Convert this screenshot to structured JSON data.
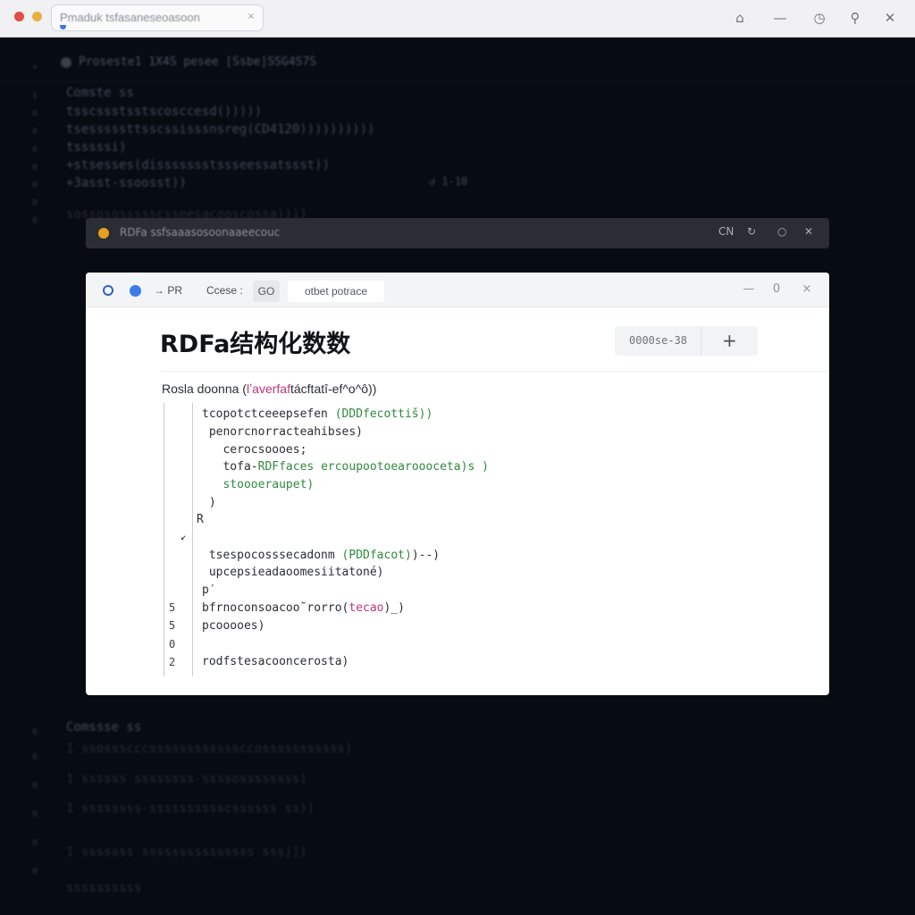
{
  "browser": {
    "address_text": "Pmaduk tsfasaneseoasoon",
    "close_tab": "×",
    "icons": [
      "home-icon",
      "minimize-icon",
      "history-icon",
      "search-icon",
      "close-icon"
    ]
  },
  "background_editor": {
    "toolbar_text": "Proseste1    1X4S  pesee    [Ssbe]SSG4S7S",
    "lines": [
      "Comste ss",
      "    tsscssstsstscosccesd()))))",
      "    tsesssssttsscssisssnsreg(CD4120))))))))))",
      "    tsssssi)",
      "    +stsesses(dissssssstssseessatssst))",
      "    +3asst-ssoosst))",
      "    sossosossssscsseesacooscossa))))",
      "Comssse ss",
      "    1 ssossscccssssssssssssccosssssssssss)",
      "    1 ssssss ssssssss-ssssossssssss)",
      "    1 ssssssss-sssssssssscssssss ss))",
      "    1 sssssss sssssssssssssss sss)))",
      "    ssssssssss"
    ],
    "side_marker": "↺  1-10"
  },
  "notification": {
    "text": "RDFa ssfsaaasosoonaaeecouc",
    "icons": [
      "language-icon",
      "refresh-icon",
      "info-icon",
      "close-icon"
    ],
    "lang_label": "CN"
  },
  "modal": {
    "tabs": {
      "arrow_label": "→ PR",
      "case_label": "Ccese :",
      "go_label": "GO",
      "active_tab": "otbet potrace"
    },
    "title": "RDFa结构化数数",
    "pill_text": "0000se-38",
    "pill_plus": "+",
    "code_header": {
      "prefix": "Rosla doonna (",
      "highlight": "lʼaverfaf",
      "suffix": "tácftatî-ef^o^ô))"
    },
    "code_lines": [
      {
        "indent": "tcopotctceeepsefen ",
        "green": "(DDDfecottiš))",
        "rest": ""
      },
      {
        "indent": " penorcnorracteahibses)",
        "green": "",
        "rest": ""
      },
      {
        "indent": "   cerocsoooes",
        "green": "",
        "rest": ";"
      },
      {
        "indent": "   tofa-",
        "green": "RDFfaces ",
        "rest": "ercoupootoearoooceta)s )"
      },
      {
        "indent": "   ",
        "green": "stoooeraupet)",
        "rest": ""
      },
      {
        "indent": " )",
        "green": "",
        "rest": ""
      }
    ],
    "r_marker": "R",
    "anchor_mark": "↙",
    "code_lines_2": [
      {
        "text": " tsespocosssecadonm ",
        "green": "(PDDfacot)",
        "rest": ")--)"
      },
      {
        "text": " upcepsieadaoomesiitatoné)",
        "green": "",
        "rest": ""
      },
      {
        "text": "p′",
        "green": "",
        "rest": ""
      },
      {
        "text": "bfrnoconsoacoo˜rorro(",
        "pink": "tecao",
        "rest": ")_)"
      },
      {
        "text": "pcooooes)",
        "green": "",
        "rest": ""
      },
      {
        "text": "",
        "green": "",
        "rest": ""
      },
      {
        "text": "rodfstesacooncerosta)",
        "green": "",
        "rest": ""
      }
    ],
    "line_numbers": [
      "5",
      "5",
      "0",
      "2"
    ],
    "window_controls": [
      "—",
      "0",
      "×"
    ]
  }
}
